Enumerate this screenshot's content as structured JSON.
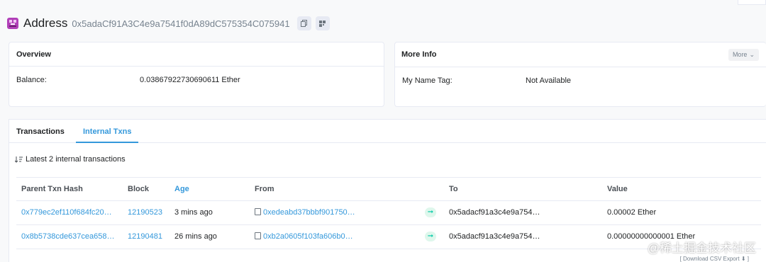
{
  "header": {
    "title": "Address",
    "hash": "0x5adaCf91A3C4e9a7541f0dA89dC575354C075941"
  },
  "overview": {
    "title": "Overview",
    "balance_label": "Balance:",
    "balance_value": "0.03867922730690611 Ether"
  },
  "more_info": {
    "title": "More Info",
    "more_button": "More",
    "name_tag_label": "My Name Tag:",
    "name_tag_value": "Not Available"
  },
  "tabs": [
    {
      "label": "Transactions",
      "active": false
    },
    {
      "label": "Internal Txns",
      "active": true
    }
  ],
  "internal": {
    "summary": "Latest 2 internal transactions",
    "columns": [
      "Parent Txn Hash",
      "Block",
      "Age",
      "From",
      "To",
      "Value"
    ],
    "rows": [
      {
        "parent_hash": "0x779ec2ef110f684fc20…",
        "block": "12190523",
        "age": "3 mins ago",
        "from": "0xedeabd37bbbf901750…",
        "to": "0x5adacf91a3c4e9a754…",
        "value": "0.00002 Ether"
      },
      {
        "parent_hash": "0x8b5738cde637cea658…",
        "block": "12190481",
        "age": "26 mins ago",
        "from": "0xb2a0605f103fa606b0…",
        "to": "0x5adacf91a3c4e9a754…",
        "value": "0.00000000000001 Ether"
      }
    ],
    "csv": "[ Download CSV Export ⬇ ]"
  },
  "watermark": "@稀土掘金技术社区",
  "colors": {
    "accent": "#3498db",
    "success": "#00c9a7",
    "border": "#e7eaf3"
  }
}
